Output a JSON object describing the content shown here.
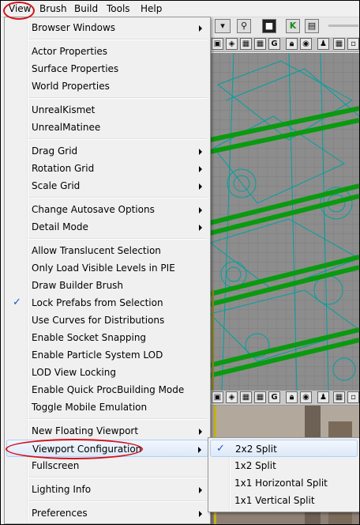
{
  "menubar": {
    "items": [
      "View",
      "Brush",
      "Build",
      "Tools",
      "Help"
    ]
  },
  "view_menu": {
    "items": [
      {
        "label": "Browser Windows",
        "submenu": true
      },
      {
        "label": "Actor Properties"
      },
      {
        "label": "Surface Properties"
      },
      {
        "label": "World Properties"
      },
      {
        "label": "UnrealKismet"
      },
      {
        "label": "UnrealMatinee"
      },
      {
        "label": "Drag Grid",
        "submenu": true
      },
      {
        "label": "Rotation Grid",
        "submenu": true
      },
      {
        "label": "Scale Grid",
        "submenu": true
      },
      {
        "label": "Change Autosave Options",
        "submenu": true
      },
      {
        "label": "Detail Mode",
        "submenu": true
      },
      {
        "label": "Allow Translucent Selection"
      },
      {
        "label": "Only Load Visible Levels in PIE"
      },
      {
        "label": "Draw Builder Brush"
      },
      {
        "label": "Lock Prefabs from Selection",
        "checked": true
      },
      {
        "label": "Use Curves for Distributions"
      },
      {
        "label": "Enable Socket Snapping"
      },
      {
        "label": "Enable Particle System LOD"
      },
      {
        "label": "LOD View Locking"
      },
      {
        "label": "Enable Quick ProcBuilding Mode"
      },
      {
        "label": "Toggle Mobile Emulation"
      },
      {
        "label": "New Floating Viewport",
        "submenu": true
      },
      {
        "label": "Viewport Configuration",
        "submenu": true,
        "highlighted": true
      },
      {
        "label": "Fullscreen"
      },
      {
        "label": "Lighting Info",
        "submenu": true
      },
      {
        "label": "Preferences",
        "submenu": true
      }
    ]
  },
  "viewport_submenu": {
    "items": [
      {
        "label": "2x2 Split",
        "checked": true,
        "highlighted": true
      },
      {
        "label": "1x2 Split"
      },
      {
        "label": "1x1 Horizontal Split"
      },
      {
        "label": "1x1 Vertical Split"
      }
    ]
  },
  "toolbar": {
    "g_button": "G",
    "k_button": "K"
  },
  "check_mark": "✓",
  "colors": {
    "annotation": "#d4121a",
    "wireframe_cyan": "#00b3b3",
    "wireframe_green": "#0a9a10",
    "grid": "#8d8d8d"
  }
}
